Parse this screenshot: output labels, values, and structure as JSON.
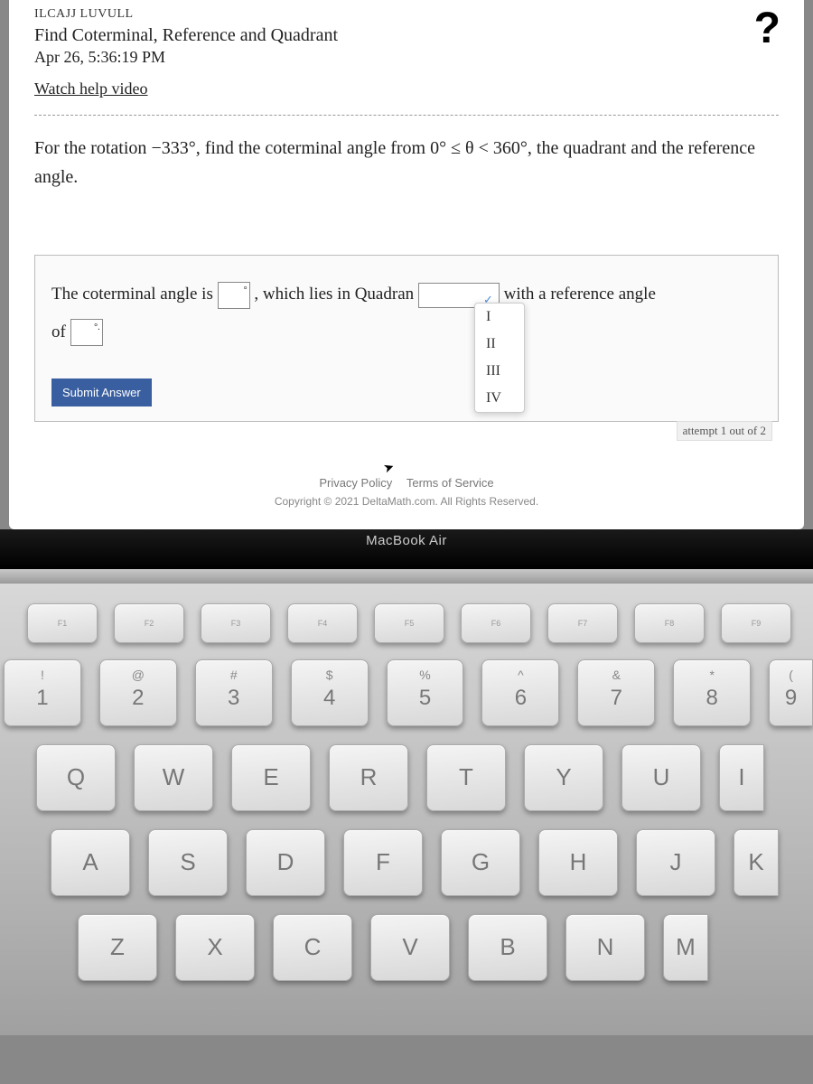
{
  "header": {
    "breadcrumb_cut": "ILCAJJ LUVULL",
    "title": "Find Coterminal, Reference and Quadrant",
    "date": "Apr 26, 5:36:19 PM",
    "watch_help": "Watch help video",
    "help_icon": "?"
  },
  "problem": {
    "text_before_angle": "For the rotation ",
    "rotation_angle": "−333°",
    "text_after_angle": ", find the coterminal angle from 0° ≤ θ < 360°, the quadrant and the reference angle."
  },
  "answer": {
    "part1": "The coterminal angle is ",
    "deg1": "°",
    "part2": ", which lies in Quadran",
    "part3": " with a reference angle",
    "part4": "of ",
    "deg2": "°.",
    "quadrant_options": [
      "I",
      "II",
      "III",
      "IV"
    ],
    "submit": "Submit Answer",
    "attempt": "attempt 1 out of 2"
  },
  "footer": {
    "privacy": "Privacy Policy",
    "terms": "Terms of Service",
    "copyright": "Copyright © 2021 DeltaMath.com. All Rights Reserved."
  },
  "laptop": {
    "label": "MacBook Air"
  },
  "keyboard": {
    "fn_row": [
      "F1",
      "F2",
      "F3",
      "F4",
      "F5",
      "F6",
      "F7",
      "F8",
      "F9"
    ],
    "num_row": [
      {
        "top": "!",
        "main": "1"
      },
      {
        "top": "@",
        "main": "2"
      },
      {
        "top": "#",
        "main": "3"
      },
      {
        "top": "$",
        "main": "4"
      },
      {
        "top": "%",
        "main": "5"
      },
      {
        "top": "^",
        "main": "6"
      },
      {
        "top": "&",
        "main": "7"
      },
      {
        "top": "*",
        "main": "8"
      },
      {
        "top": "(",
        "main": "9"
      }
    ],
    "row_q": [
      "Q",
      "W",
      "E",
      "R",
      "T",
      "Y",
      "U",
      "I"
    ],
    "row_a": [
      "A",
      "S",
      "D",
      "F",
      "G",
      "H",
      "J",
      "K"
    ],
    "row_z": [
      "Z",
      "X",
      "C",
      "V",
      "B",
      "N",
      "M"
    ]
  }
}
